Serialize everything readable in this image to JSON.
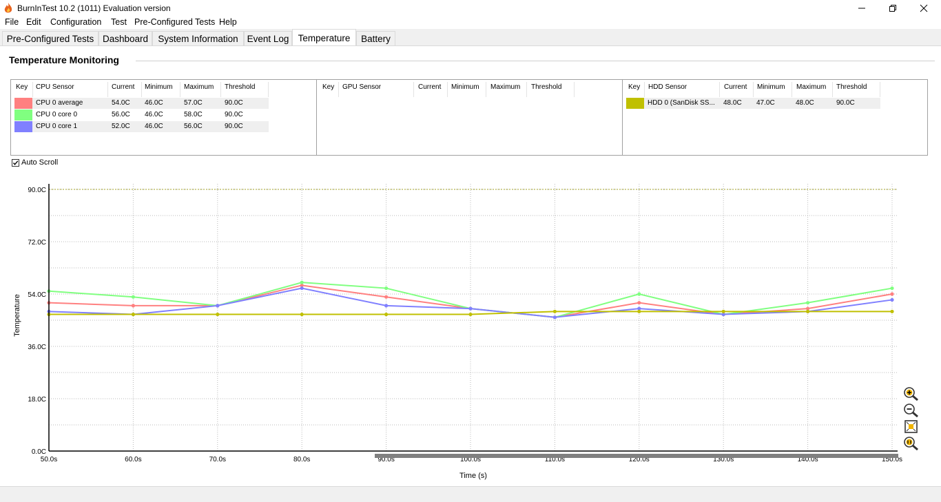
{
  "window": {
    "title": "BurnInTest 10.2 (1011) Evaluation version"
  },
  "menu": [
    "File",
    "Edit",
    "Configuration",
    "Test",
    "Pre-Configured Tests",
    "Help"
  ],
  "tabs": [
    {
      "label": "Pre-Configured Tests",
      "active": false
    },
    {
      "label": "Dashboard",
      "active": false
    },
    {
      "label": "System Information",
      "active": false
    },
    {
      "label": "Event Log",
      "active": false
    },
    {
      "label": "Temperature",
      "active": true
    },
    {
      "label": "Battery",
      "active": false
    }
  ],
  "section_title": "Temperature Monitoring",
  "cpu_table": {
    "headers": [
      "Key",
      "CPU Sensor",
      "Current",
      "Minimum",
      "Maximum",
      "Threshold"
    ],
    "rows": [
      {
        "color": "#ff8080",
        "sensor": "CPU 0 average",
        "current": "54.0C",
        "minimum": "46.0C",
        "maximum": "57.0C",
        "threshold": "90.0C"
      },
      {
        "color": "#80ff80",
        "sensor": "CPU 0 core 0",
        "current": "56.0C",
        "minimum": "46.0C",
        "maximum": "58.0C",
        "threshold": "90.0C"
      },
      {
        "color": "#8080ff",
        "sensor": "CPU 0 core 1",
        "current": "52.0C",
        "minimum": "46.0C",
        "maximum": "56.0C",
        "threshold": "90.0C"
      }
    ]
  },
  "gpu_table": {
    "headers": [
      "Key",
      "GPU Sensor",
      "Current",
      "Minimum",
      "Maximum",
      "Threshold"
    ],
    "rows": []
  },
  "hdd_table": {
    "headers": [
      "Key",
      "HDD Sensor",
      "Current",
      "Minimum",
      "Maximum",
      "Threshold"
    ],
    "rows": [
      {
        "color": "#c0c000",
        "sensor": "HDD 0 (SanDisk SS...",
        "current": "48.0C",
        "minimum": "47.0C",
        "maximum": "48.0C",
        "threshold": "90.0C"
      }
    ]
  },
  "auto_scroll": {
    "label": "Auto Scroll",
    "checked": true
  },
  "chart_data": {
    "type": "line",
    "xlabel": "Time (s)",
    "ylabel": "Temperature",
    "x": [
      50,
      60,
      70,
      80,
      90,
      100,
      110,
      120,
      130,
      140,
      150
    ],
    "x_ticks": [
      "50.0s",
      "60.0s",
      "70.0s",
      "80.0s",
      "90.0s",
      "100.0s",
      "110.0s",
      "120.0s",
      "130.0s",
      "140.0s",
      "150.0s"
    ],
    "y_ticks": [
      "0.0C",
      "18.0C",
      "36.0C",
      "54.0C",
      "72.0C",
      "90.0C"
    ],
    "ylim": [
      0,
      90
    ],
    "xlim": [
      50,
      150
    ],
    "threshold": 90,
    "grid": true,
    "series": [
      {
        "name": "CPU 0 average",
        "color": "#ff8080",
        "values": [
          51,
          50,
          50,
          57,
          53,
          49,
          46,
          51,
          47,
          49,
          54
        ]
      },
      {
        "name": "CPU 0 core 0",
        "color": "#80ff80",
        "values": [
          55,
          53,
          50,
          58,
          56,
          49,
          46,
          54,
          47,
          51,
          56
        ]
      },
      {
        "name": "CPU 0 core 1",
        "color": "#8080ff",
        "values": [
          48,
          47,
          50,
          56,
          50,
          49,
          46,
          49,
          47,
          48,
          52
        ]
      },
      {
        "name": "HDD 0 (SanDisk SS...",
        "color": "#c0c000",
        "values": [
          47,
          47,
          47,
          47,
          47,
          47,
          48,
          48,
          48,
          48,
          48
        ]
      }
    ]
  },
  "zoom_controls": [
    "zoom-in-icon",
    "zoom-out-icon",
    "zoom-fit-icon",
    "zoom-reset-icon"
  ]
}
